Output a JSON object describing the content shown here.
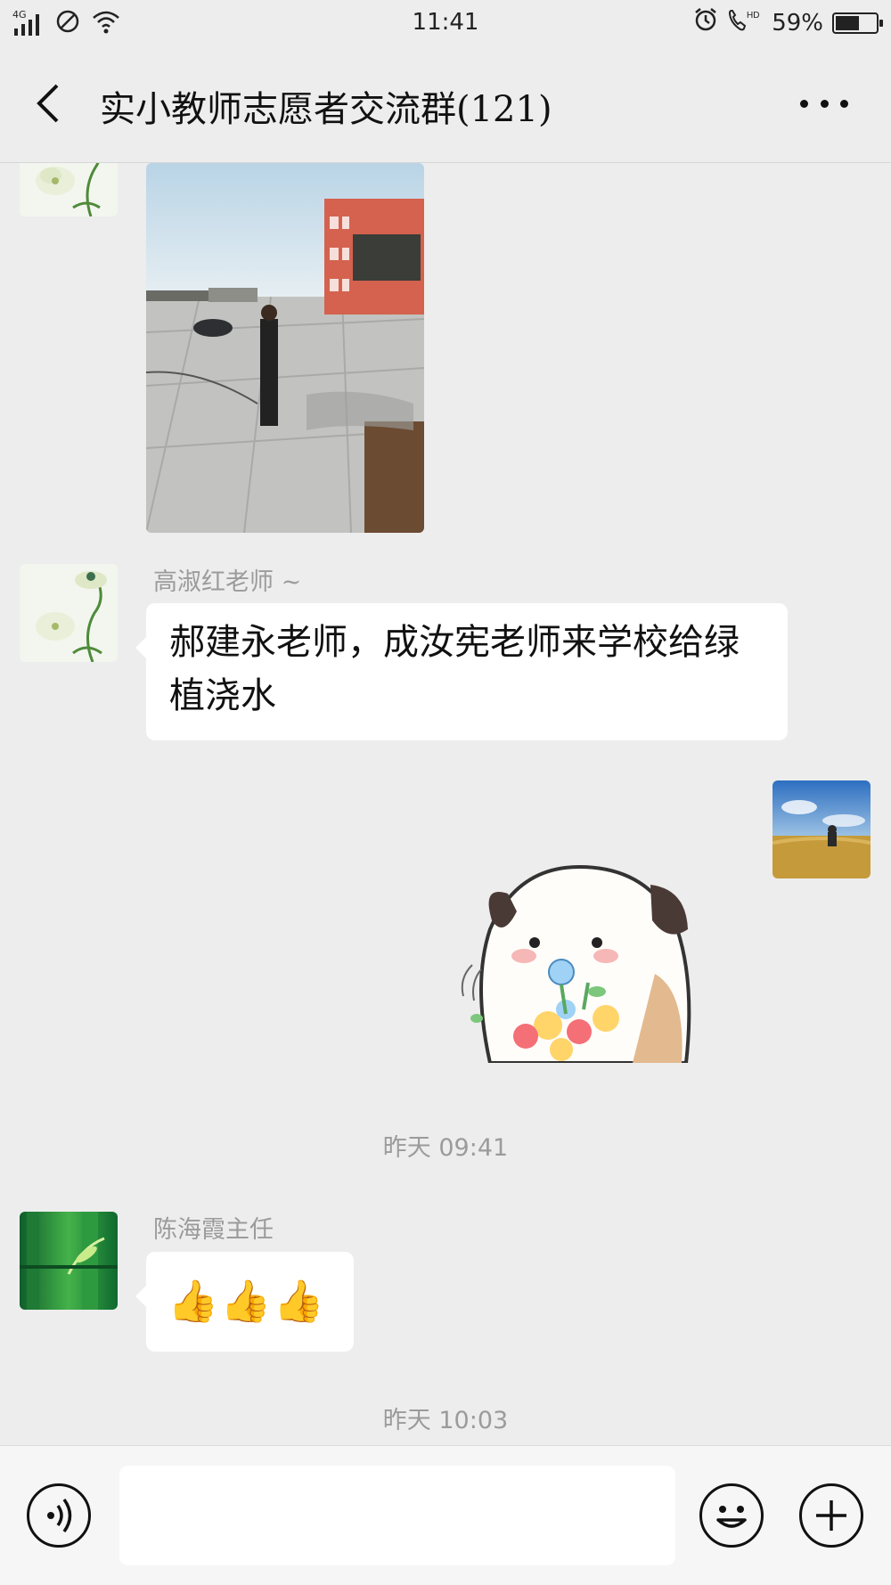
{
  "status_bar": {
    "network": "4G",
    "time": "11:41",
    "battery_percent": "59%",
    "battery_level": 0.59,
    "icons": [
      "signal-icon",
      "no-disturb-icon",
      "wifi-icon",
      "alarm-icon",
      "hd-call-icon",
      "battery-icon"
    ]
  },
  "header": {
    "title": "实小教师志愿者交流群(121)",
    "back_icon": "chevron-left-icon",
    "more_icon": "more-icon"
  },
  "messages": [
    {
      "type": "image",
      "side": "left",
      "avatar": "flower-avatar",
      "image": "photo-schoolyard-watering"
    },
    {
      "type": "text",
      "side": "left",
      "avatar": "flower-avatar",
      "sender": "高淑红老师 ~",
      "text": "郝建永老师，成汝宪老师来学校给绿植浇水"
    },
    {
      "type": "sticker",
      "side": "right",
      "avatar": "field-avatar",
      "sticker": "dog-with-flowers-sticker"
    },
    {
      "type": "time",
      "text": "昨天 09:41"
    },
    {
      "type": "text",
      "side": "left",
      "avatar": "bamboo-avatar",
      "sender": "陈海霞主任",
      "text": "👍👍👍"
    },
    {
      "type": "time",
      "text": "昨天 10:03"
    }
  ],
  "input_bar": {
    "placeholder": "",
    "voice_icon": "voice-icon",
    "emoji_icon": "emoji-icon",
    "plus_icon": "plus-icon"
  },
  "colors": {
    "background": "#ededed",
    "bubble": "#ffffff",
    "meta_text": "#9b9b9b"
  }
}
